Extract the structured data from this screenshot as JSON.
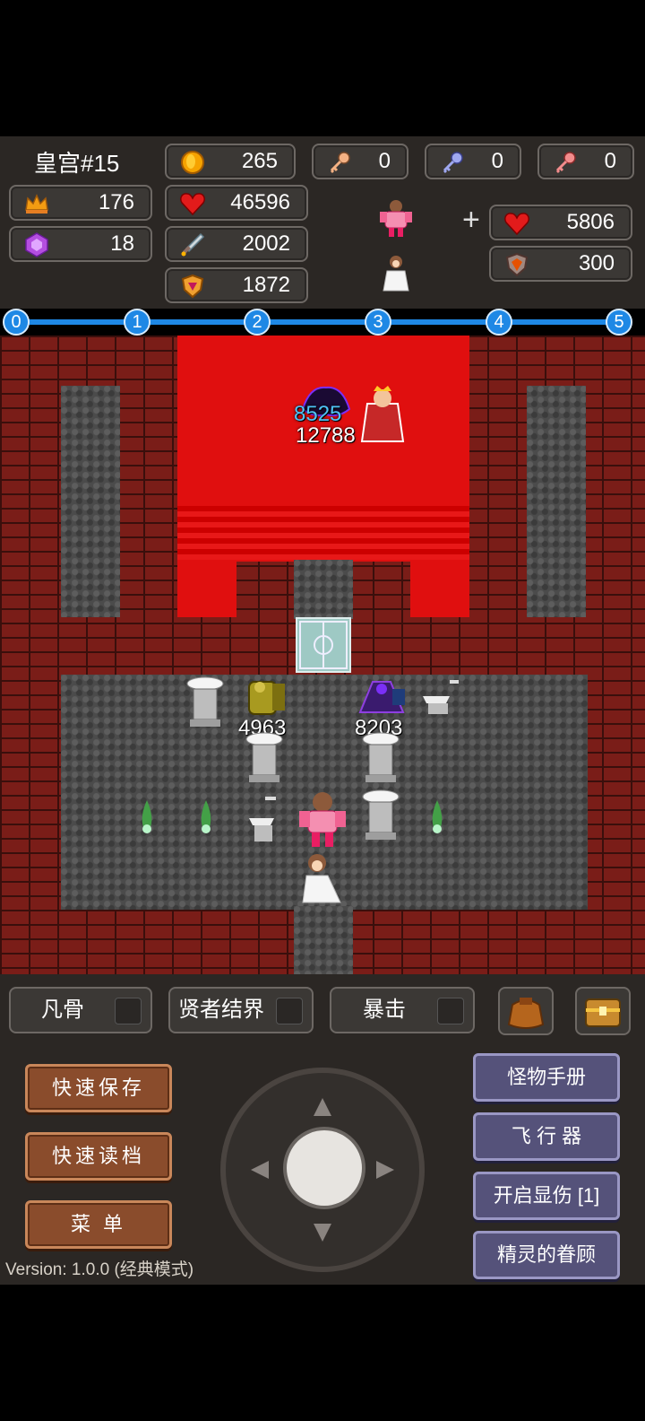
{
  "hud": {
    "floor": "皇宫#15",
    "level": "176",
    "gems": "18",
    "gold": "265",
    "hp": "46596",
    "attack": "2002",
    "defense": "1872",
    "key_yellow": "0",
    "key_blue": "0",
    "key_red": "0",
    "bonus_hp": "5806",
    "bonus_def": "300"
  },
  "floor_track": [
    "0",
    "1",
    "2",
    "3",
    "4",
    "5"
  ],
  "map": {
    "damage_boss_top": "8525",
    "damage_boss_bottom": "12788",
    "damage_left": "4963",
    "damage_right": "8203"
  },
  "toggles": [
    {
      "label": "凡骨"
    },
    {
      "label": "贤者结界"
    },
    {
      "label": "暴击"
    }
  ],
  "buttons": {
    "quick_save": "快速保存",
    "quick_load": "快速读档",
    "menu": "菜  单",
    "monster_manual": "怪物手册",
    "flyer": "飞 行 器",
    "show_damage": "开启显伤 [1]",
    "fairy_favor": "精灵的眷顾"
  },
  "version": "Version: 1.0.0 (经典模式)",
  "colors": {
    "accent": "#1e88e5",
    "carpet": "#e00f0f"
  }
}
